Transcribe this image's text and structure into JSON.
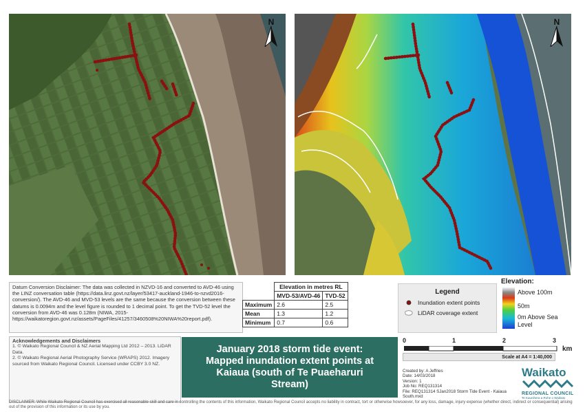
{
  "north_label": "N",
  "disclaimer": {
    "text": "Datum Conversion Disclaimer: The data was collected in NZVD-16 and converted to AVD-46 using the LINZ conversation table (https://data.linz.govt.nz/layer/53417-auckland-1946-to-nzvd2016-conversion/). The AVD-46 and MVD-53 levels are the same because the conversion between these datums is 0.0094m and the level figure is rounded to 1 decimal point. To get the TVD-52 level the conversion from AVD-46 was 0.128m (NIWA, 2015- https://waikatoregion.govt.nz/assets/PageFiles/41257/3460508%20NIWA%20report.pdf)."
  },
  "elevation_table": {
    "header": "Elevation in metres RL",
    "columns": [
      "MVD-53/AVD-46",
      "TVD-52"
    ],
    "rows": [
      {
        "label": "Maximum",
        "v1": "2.6",
        "v2": "2.5"
      },
      {
        "label": "Mean",
        "v1": "1.3",
        "v2": "1.2"
      },
      {
        "label": "Minimum",
        "v1": "0.7",
        "v2": "0.6"
      }
    ]
  },
  "legend": {
    "title": "Legend",
    "points_label": "Inundation extent points",
    "lidar_label": "LiDAR coverage extent"
  },
  "elevation_legend": {
    "title": "Elevation:",
    "high": "Above 100m",
    "mid": "50m",
    "low1": "0m Above Sea",
    "low2": "Level"
  },
  "acknowledgements": {
    "title": "Acknowledgements and Disclaimers",
    "line1": "1. © Waikato Regional Council & NZ Aerial Mapping Ltd 2012 – 2013. LiDAR Data.",
    "line2": "2. © Waikato Regional Aerial Photography Service (WRAPS) 2012. Imagery sourced from Waikato Regional Council. Licensed under CCBY 3.0 NZ."
  },
  "title": {
    "line1": "January 2018 storm tide event:",
    "line2": "Mapped inundation extent points at",
    "line3": "Kaiaua (south of Te Puaeharuri",
    "line4": "Stream)"
  },
  "scale": {
    "ticks": [
      "0",
      "1",
      "2",
      "3"
    ],
    "unit": "km",
    "text": "Scale at A4 = 1:40,000"
  },
  "meta": {
    "created": "Created by: A Jeffries",
    "date": "Date: 14/03/2018",
    "version": "Version: 1",
    "job": "Job No: REQ131314",
    "file": "File: REQ131314 SJan2018 Storm Tide Event - Kaiaua South.mxd"
  },
  "logo": {
    "name": "Waikato",
    "sub": "REGIONAL COUNCIL",
    "tagline": "Te Kaunihera a Rohe o Waikato"
  },
  "footer": "DISCLAIMER: While Waikato Regional Council has exercised all reasonable skill and care in controlling the contents of this information, Waikato Regional Council accepts no liability in contract, tort or otherwise howsoever, for any loss, damage, injury expense (whether direct, indirect or consequential) arising out of the provision of this information or its use by you.",
  "colors": {
    "title_bg": "#2d6e63",
    "point": "#8b1010",
    "logo": "#2d7a88"
  }
}
